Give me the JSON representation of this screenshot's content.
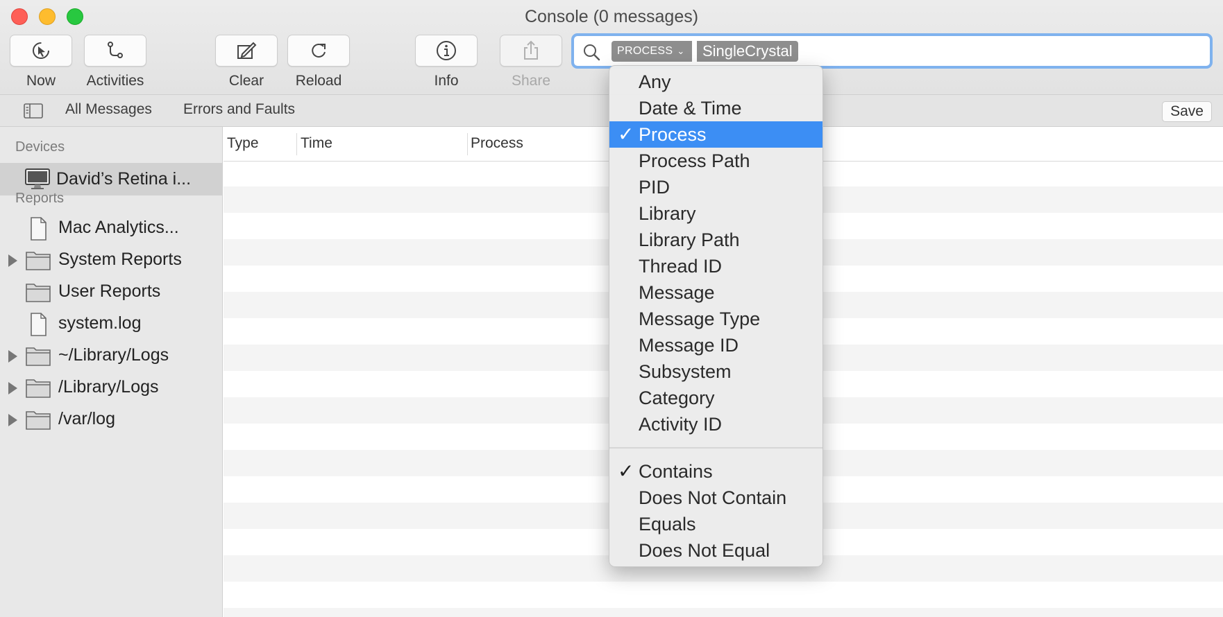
{
  "window": {
    "title": "Console (0 messages)"
  },
  "toolbar": {
    "now": "Now",
    "activities": "Activities",
    "clear": "Clear",
    "reload": "Reload",
    "info": "Info",
    "share": "Share"
  },
  "search": {
    "token_category": "PROCESS",
    "token_value": "SingleCrystal"
  },
  "filterbar": {
    "all_messages": "All Messages",
    "errors_and_faults": "Errors and Faults",
    "save": "Save"
  },
  "sidebar": {
    "devices_header": "Devices",
    "device": "David’s Retina i...",
    "reports_header": "Reports",
    "reports": [
      {
        "label": "Mac Analytics...",
        "icon": "document-icon",
        "expandable": false
      },
      {
        "label": "System Reports",
        "icon": "folder-icon",
        "expandable": true
      },
      {
        "label": "User Reports",
        "icon": "folder-icon",
        "expandable": false
      },
      {
        "label": "system.log",
        "icon": "document-icon",
        "expandable": false
      },
      {
        "label": "~/Library/Logs",
        "icon": "folder-icon",
        "expandable": true
      },
      {
        "label": "/Library/Logs",
        "icon": "folder-icon",
        "expandable": true
      },
      {
        "label": "/var/log",
        "icon": "folder-icon",
        "expandable": true
      }
    ]
  },
  "table": {
    "columns": [
      "Type",
      "Time",
      "Process"
    ]
  },
  "menu": {
    "fields": [
      {
        "label": "Any",
        "checked": false
      },
      {
        "label": "Date & Time",
        "checked": false
      },
      {
        "label": "Process",
        "checked": true
      },
      {
        "label": "Process Path",
        "checked": false
      },
      {
        "label": "PID",
        "checked": false
      },
      {
        "label": "Library",
        "checked": false
      },
      {
        "label": "Library Path",
        "checked": false
      },
      {
        "label": "Thread ID",
        "checked": false
      },
      {
        "label": "Message",
        "checked": false
      },
      {
        "label": "Message Type",
        "checked": false
      },
      {
        "label": "Message ID",
        "checked": false
      },
      {
        "label": "Subsystem",
        "checked": false
      },
      {
        "label": "Category",
        "checked": false
      },
      {
        "label": "Activity ID",
        "checked": false
      }
    ],
    "operators": [
      {
        "label": "Contains",
        "checked": true
      },
      {
        "label": "Does Not Contain",
        "checked": false
      },
      {
        "label": "Equals",
        "checked": false
      },
      {
        "label": "Does Not Equal",
        "checked": false
      }
    ],
    "check_glyph": "✓"
  },
  "colors": {
    "selection": "#3c8ef4",
    "search_focus_ring": "#7fb2ee",
    "token_bg": "#8e8e8e"
  }
}
